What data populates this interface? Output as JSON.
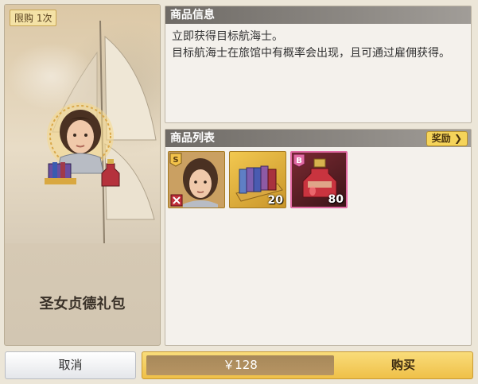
{
  "preview": {
    "limit_badge": "限购 1次",
    "pack_name": "圣女贞德礼包"
  },
  "info": {
    "header": "商品信息",
    "line1": "立即获得目标航海士。",
    "line2": "目标航海士在旅馆中有概率会出现，且可通过雇佣获得。"
  },
  "list": {
    "header": "商品列表",
    "reward_label": "奖励 ❯",
    "items": [
      {
        "icon": "navigator-portrait-icon",
        "rank": "S",
        "quantity": ""
      },
      {
        "icon": "book-stack-icon",
        "rank": "",
        "quantity": "20"
      },
      {
        "icon": "potion-bottle-icon",
        "rank": "B",
        "quantity": "80"
      }
    ]
  },
  "footer": {
    "cancel_label": "取消",
    "price": "￥128",
    "buy_label": "购买"
  },
  "colors": {
    "accent_gold": "#f5d45a",
    "item_rare_border": "#e06aa3",
    "header_gray": "#6f6b66"
  }
}
